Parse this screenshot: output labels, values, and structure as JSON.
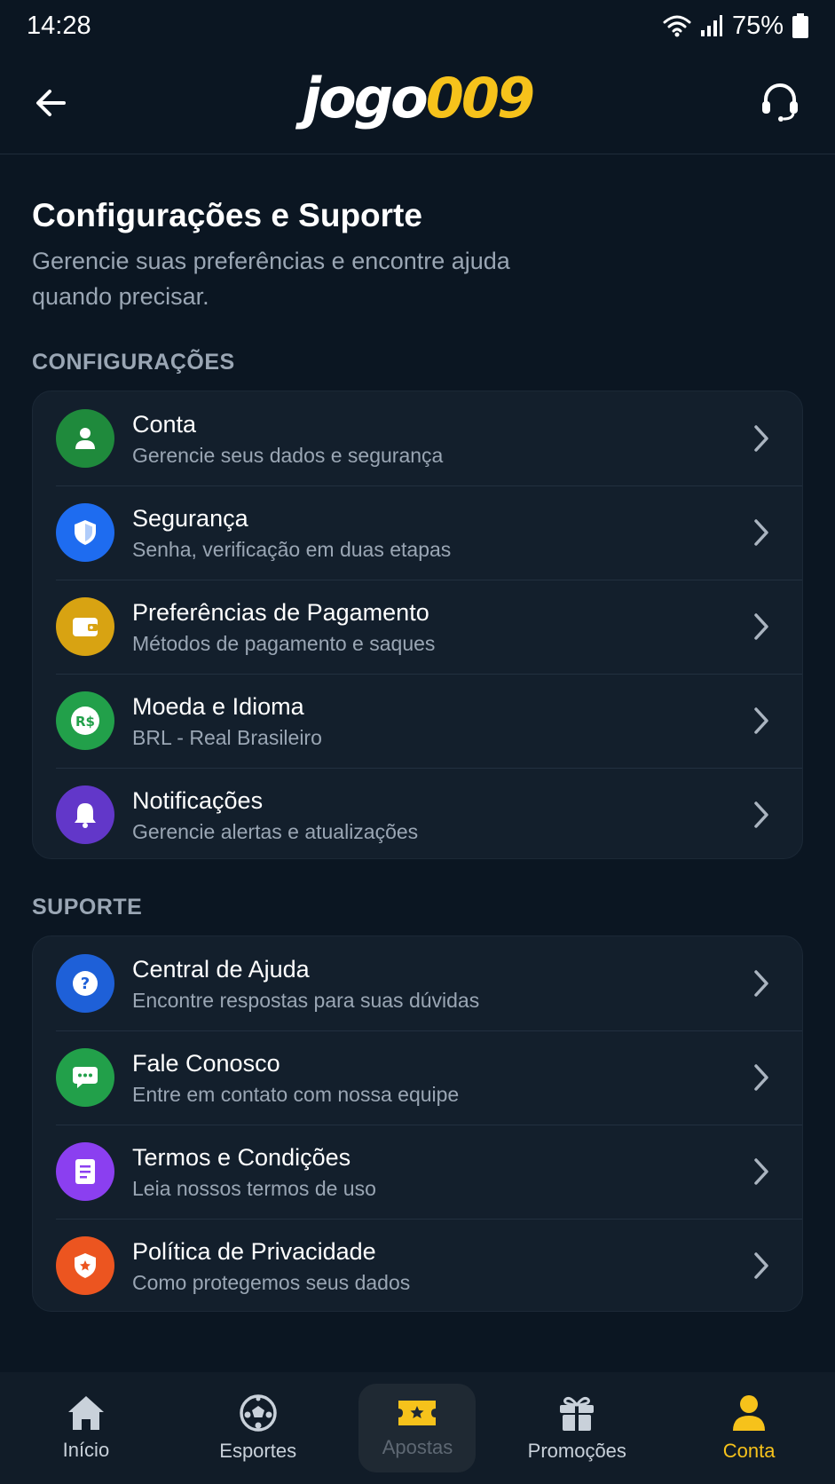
{
  "status": {
    "time": "14:28",
    "battery": "75%"
  },
  "header": {
    "logo_part1": "jogo",
    "logo_part2": "009"
  },
  "page": {
    "title": "Configurações e Suporte",
    "subtitle": "Gerencie suas preferências e encontre ajuda quando precisar."
  },
  "sections": {
    "settings": {
      "label": "CONFIGURAÇÕES",
      "items": [
        {
          "title": "Conta",
          "subtitle": "Gerencie seus dados e segurança",
          "icon": "user-icon",
          "color": "#1f8a3c"
        },
        {
          "title": "Segurança",
          "subtitle": "Senha, verificação em duas etapas",
          "icon": "shield-icon",
          "color": "#1e6cf0"
        },
        {
          "title": "Preferências de Pagamento",
          "subtitle": "Métodos de pagamento e saques",
          "icon": "wallet-icon",
          "color": "#d8a312"
        },
        {
          "title": "Moeda e Idioma",
          "subtitle": "BRL - Real Brasileiro",
          "icon": "currency-icon",
          "color": "#22a04a"
        },
        {
          "title": "Notificações",
          "subtitle": "Gerencie alertas e atualizações",
          "icon": "bell-icon",
          "color": "#6237c9"
        }
      ]
    },
    "support": {
      "label": "SUPORTE",
      "items": [
        {
          "title": "Central de Ajuda",
          "subtitle": "Encontre respostas para suas dúvidas",
          "icon": "help-icon",
          "color": "#1e60d8"
        },
        {
          "title": "Fale Conosco",
          "subtitle": "Entre em contato com nossa equipe",
          "icon": "chat-icon",
          "color": "#22a04a"
        },
        {
          "title": "Termos e Condições",
          "subtitle": "Leia nossos termos de uso",
          "icon": "document-icon",
          "color": "#8b3ff0"
        },
        {
          "title": "Política de Privacidade",
          "subtitle": "Como protegemos seus dados",
          "icon": "privacy-shield-icon",
          "color": "#ec5520"
        }
      ]
    }
  },
  "nav": [
    {
      "label": "Início",
      "icon": "home-icon"
    },
    {
      "label": "Esportes",
      "icon": "soccer-ball-icon"
    },
    {
      "label": "Apostas",
      "icon": "ticket-icon"
    },
    {
      "label": "Promoções",
      "icon": "gift-icon"
    },
    {
      "label": "Conta",
      "icon": "user-icon"
    }
  ],
  "colors": {
    "accent": "#f6c21b",
    "background": "#0b1622",
    "card": "#131f2c"
  }
}
